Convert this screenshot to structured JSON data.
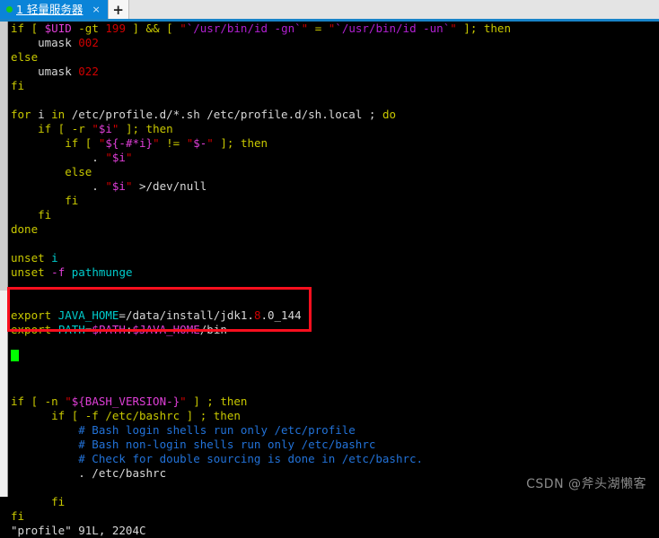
{
  "tabbar": {
    "status_dot": "green-dot-icon",
    "tab_label": "1 轻量服务器",
    "close_label": "×",
    "new_tab_label": "+"
  },
  "terminal": {
    "lines": [
      [
        {
          "t": "if [ ",
          "c": "kw"
        },
        {
          "t": "$UID",
          "c": "var"
        },
        {
          "t": " -gt ",
          "c": "kw"
        },
        {
          "t": "199",
          "c": "num"
        },
        {
          "t": " ] && [ ",
          "c": "kw"
        },
        {
          "t": "\"",
          "c": "str"
        },
        {
          "t": "`/usr/bin/id -gn`",
          "c": "strc"
        },
        {
          "t": "\"",
          "c": "str"
        },
        {
          "t": " = ",
          "c": "kw"
        },
        {
          "t": "\"",
          "c": "str"
        },
        {
          "t": "`/usr/bin/id -un`",
          "c": "strc"
        },
        {
          "t": "\"",
          "c": "str"
        },
        {
          "t": " ]; ",
          "c": "kw"
        },
        {
          "t": "then",
          "c": "kw"
        }
      ],
      [
        {
          "t": "    umask ",
          "c": "pl"
        },
        {
          "t": "002",
          "c": "num"
        }
      ],
      [
        {
          "t": "else",
          "c": "kw"
        }
      ],
      [
        {
          "t": "    umask ",
          "c": "pl"
        },
        {
          "t": "022",
          "c": "num"
        }
      ],
      [
        {
          "t": "fi",
          "c": "kw"
        }
      ],
      [],
      [
        {
          "t": "for",
          "c": "kw"
        },
        {
          "t": " i ",
          "c": "pl"
        },
        {
          "t": "in",
          "c": "kw"
        },
        {
          "t": " /etc/profile.d/*.sh /etc/profile.d/sh.local ; ",
          "c": "pl"
        },
        {
          "t": "do",
          "c": "kw"
        }
      ],
      [
        {
          "t": "    if [ -r ",
          "c": "kw"
        },
        {
          "t": "\"",
          "c": "str"
        },
        {
          "t": "$i",
          "c": "var"
        },
        {
          "t": "\"",
          "c": "str"
        },
        {
          "t": " ]; ",
          "c": "kw"
        },
        {
          "t": "then",
          "c": "kw"
        }
      ],
      [
        {
          "t": "        if [ ",
          "c": "kw"
        },
        {
          "t": "\"",
          "c": "str"
        },
        {
          "t": "${-#*i}",
          "c": "var"
        },
        {
          "t": "\"",
          "c": "str"
        },
        {
          "t": " != ",
          "c": "kw"
        },
        {
          "t": "\"",
          "c": "str"
        },
        {
          "t": "$-",
          "c": "var"
        },
        {
          "t": "\"",
          "c": "str"
        },
        {
          "t": " ]; ",
          "c": "kw"
        },
        {
          "t": "then",
          "c": "kw"
        }
      ],
      [
        {
          "t": "            . ",
          "c": "pl"
        },
        {
          "t": "\"",
          "c": "str"
        },
        {
          "t": "$i",
          "c": "var"
        },
        {
          "t": "\"",
          "c": "str"
        }
      ],
      [
        {
          "t": "        else",
          "c": "kw"
        }
      ],
      [
        {
          "t": "            . ",
          "c": "pl"
        },
        {
          "t": "\"",
          "c": "str"
        },
        {
          "t": "$i",
          "c": "var"
        },
        {
          "t": "\"",
          "c": "str"
        },
        {
          "t": " >/dev/null",
          "c": "pl"
        }
      ],
      [
        {
          "t": "        fi",
          "c": "kw"
        }
      ],
      [
        {
          "t": "    fi",
          "c": "kw"
        }
      ],
      [
        {
          "t": "done",
          "c": "kw"
        }
      ],
      [],
      [
        {
          "t": "unset",
          "c": "kw"
        },
        {
          "t": " ",
          "c": "pl"
        },
        {
          "t": "i",
          "c": "id"
        }
      ],
      [
        {
          "t": "unset",
          "c": "kw"
        },
        {
          "t": " ",
          "c": "pl"
        },
        {
          "t": "-f",
          "c": "var"
        },
        {
          "t": " ",
          "c": "pl"
        },
        {
          "t": "pathmunge",
          "c": "id"
        }
      ],
      [],
      [],
      [
        {
          "t": "export",
          "c": "kw"
        },
        {
          "t": " ",
          "c": "pl"
        },
        {
          "t": "JAVA_HOME",
          "c": "id"
        },
        {
          "t": "=/data/install/jdk1.",
          "c": "pl"
        },
        {
          "t": "8",
          "c": "num"
        },
        {
          "t": ".0_144",
          "c": "pl"
        }
      ],
      [
        {
          "t": "export",
          "c": "kw"
        },
        {
          "t": " ",
          "c": "pl"
        },
        {
          "t": "PATH",
          "c": "id"
        },
        {
          "t": "=",
          "c": "pl"
        },
        {
          "t": "$PATH",
          "c": "var"
        },
        {
          "t": ":",
          "c": "pl"
        },
        {
          "t": "$JAVA_HOME",
          "c": "var"
        },
        {
          "t": "/bin",
          "c": "pl"
        }
      ],
      [],
      [],
      [],
      [],
      [
        {
          "t": "if [ -n ",
          "c": "kw"
        },
        {
          "t": "\"",
          "c": "str"
        },
        {
          "t": "${BASH_VERSION-}",
          "c": "var"
        },
        {
          "t": "\"",
          "c": "str"
        },
        {
          "t": " ] ; ",
          "c": "kw"
        },
        {
          "t": "then",
          "c": "kw"
        }
      ],
      [
        {
          "t": "      if [ -f /etc/bashrc ] ; ",
          "c": "kw"
        },
        {
          "t": "then",
          "c": "kw"
        }
      ],
      [
        {
          "t": "          # Bash login shells run only /etc/profile",
          "c": "cmt"
        }
      ],
      [
        {
          "t": "          # Bash non-login shells run only /etc/bashrc",
          "c": "cmt"
        }
      ],
      [
        {
          "t": "          # Check for double sourcing is done in /etc/bashrc.",
          "c": "cmt"
        }
      ],
      [
        {
          "t": "          . /etc/bashrc",
          "c": "pl"
        }
      ],
      [],
      [
        {
          "t": "      fi",
          "c": "kw"
        }
      ],
      [
        {
          "t": "fi",
          "c": "kw"
        }
      ],
      [
        {
          "t": "\"profile\" 91L, 2204C",
          "c": "pl"
        }
      ]
    ],
    "status_line": "\"profile\" 91L, 2204C",
    "cursor": "block-cursor"
  },
  "annotation": {
    "highlight_box": "red-rectangle-highlight",
    "color": "#fa0f1e"
  },
  "watermark": {
    "text": "CSDN @斧头湖懒客"
  }
}
